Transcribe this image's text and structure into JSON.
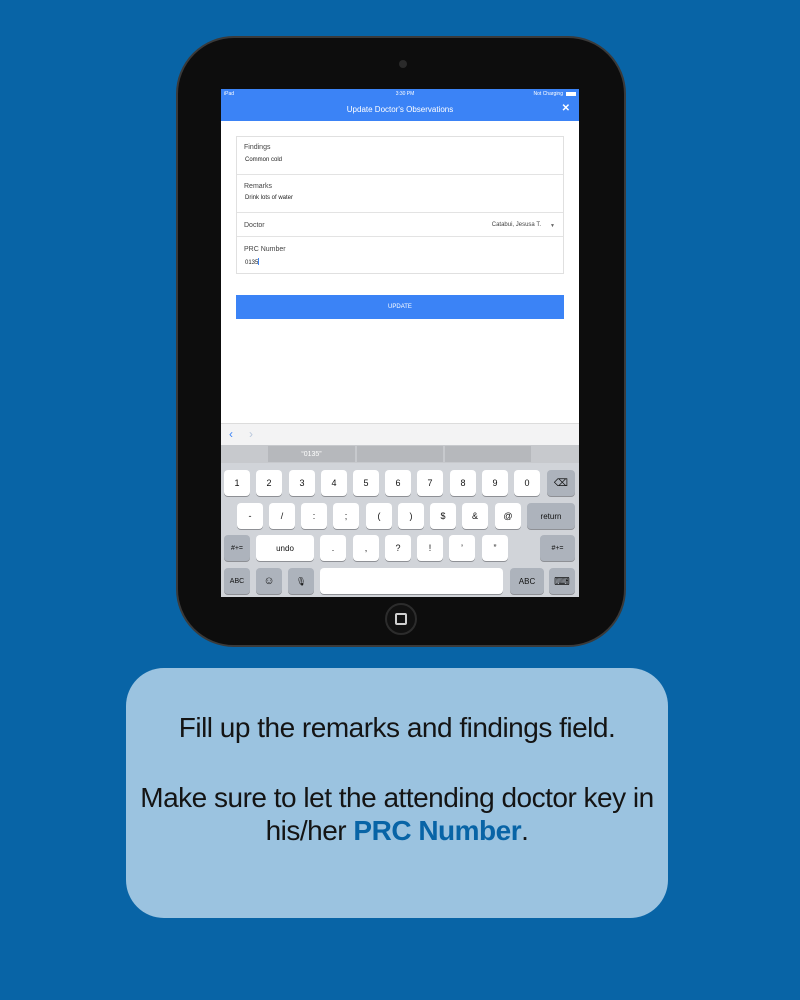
{
  "status_bar": {
    "device": "iPad",
    "time": "3:30 PM",
    "charging": "Not Charging"
  },
  "nav": {
    "title": "Update Doctor's Observations",
    "close_label": "✕"
  },
  "form": {
    "findings": {
      "label": "Findings",
      "value": "Common cold"
    },
    "remarks": {
      "label": "Remarks",
      "value": "Drink lots of water"
    },
    "doctor": {
      "label": "Doctor",
      "value": "Catabui, Jesusa T.",
      "caret": "▼"
    },
    "prc": {
      "label": "PRC Number",
      "value": "0135"
    }
  },
  "update_label": "UPDATE",
  "keyboard": {
    "nav_prev": "‹",
    "nav_next": "›",
    "suggestions": [
      "“0135”",
      "",
      ""
    ],
    "row1": [
      "1",
      "2",
      "3",
      "4",
      "5",
      "6",
      "7",
      "8",
      "9",
      "0"
    ],
    "delete_icon": "⌫",
    "row2": [
      "-",
      "/",
      ":",
      ";",
      "(",
      ")",
      "$",
      "&",
      "@"
    ],
    "return_label": "return",
    "row3_left": "#+=",
    "undo_label": "undo",
    "row3": [
      ".",
      ",",
      "?",
      "!",
      "’",
      "”"
    ],
    "row3_right": "#+=",
    "abc_left": "ABC",
    "emoji_icon": "☺",
    "mic_icon": "🎙",
    "abc_right": "ABC",
    "hide_keyboard_icon": "⌨"
  },
  "instructions": {
    "line1": "Fill up the remarks and findings field.",
    "line2": "Make sure to let the attending doctor key in",
    "line3_prefix": "his/her ",
    "line3_highlight": "PRC Number",
    "line3_suffix": ".",
    "highlight_color": "#0864a6"
  }
}
